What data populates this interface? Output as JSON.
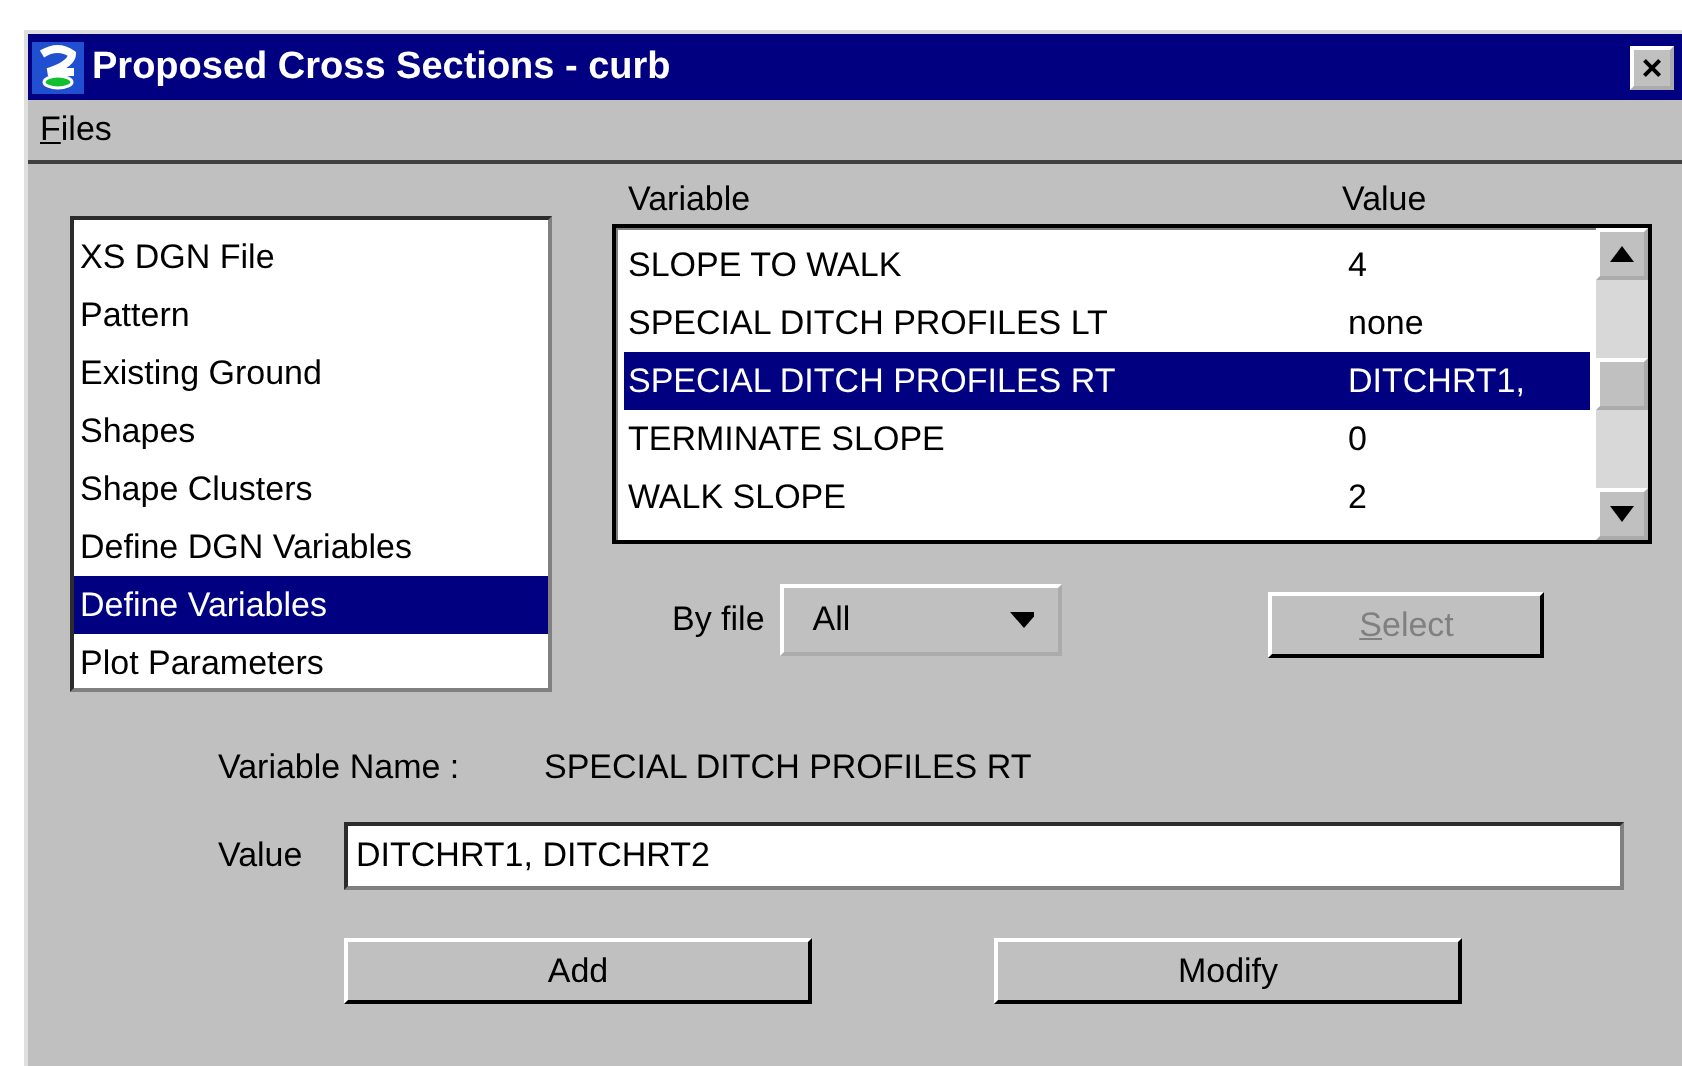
{
  "window": {
    "title": "Proposed Cross Sections - curb",
    "close": "×"
  },
  "menu": [
    {
      "label": "Files"
    }
  ],
  "categories": [
    {
      "label": "XS DGN File",
      "selected": false
    },
    {
      "label": "Pattern",
      "selected": false
    },
    {
      "label": "Existing Ground",
      "selected": false
    },
    {
      "label": "Shapes",
      "selected": false
    },
    {
      "label": "Shape Clusters",
      "selected": false
    },
    {
      "label": "Define DGN Variables",
      "selected": false
    },
    {
      "label": "Define Variables",
      "selected": true
    },
    {
      "label": "Plot Parameters",
      "selected": false
    }
  ],
  "table": {
    "columns": [
      "Variable",
      "Value"
    ],
    "rows": [
      {
        "variable": "SLOPE TO WALK",
        "value": "4",
        "selected": false
      },
      {
        "variable": "SPECIAL DITCH PROFILES LT",
        "value": "none",
        "selected": false
      },
      {
        "variable": "SPECIAL DITCH PROFILES RT",
        "value": "DITCHRT1,",
        "selected": true
      },
      {
        "variable": "TERMINATE SLOPE",
        "value": "0",
        "selected": false
      },
      {
        "variable": "WALK SLOPE",
        "value": "2",
        "selected": false
      }
    ]
  },
  "by_file": {
    "label": "By file",
    "value": "All"
  },
  "select_button": {
    "label": "Select",
    "disabled": true
  },
  "variable_name": {
    "label": "Variable Name :",
    "value": "SPECIAL DITCH PROFILES RT"
  },
  "value_field": {
    "label": "Value",
    "value": "DITCHRT1, DITCHRT2"
  },
  "buttons": [
    "Add",
    "Modify"
  ]
}
